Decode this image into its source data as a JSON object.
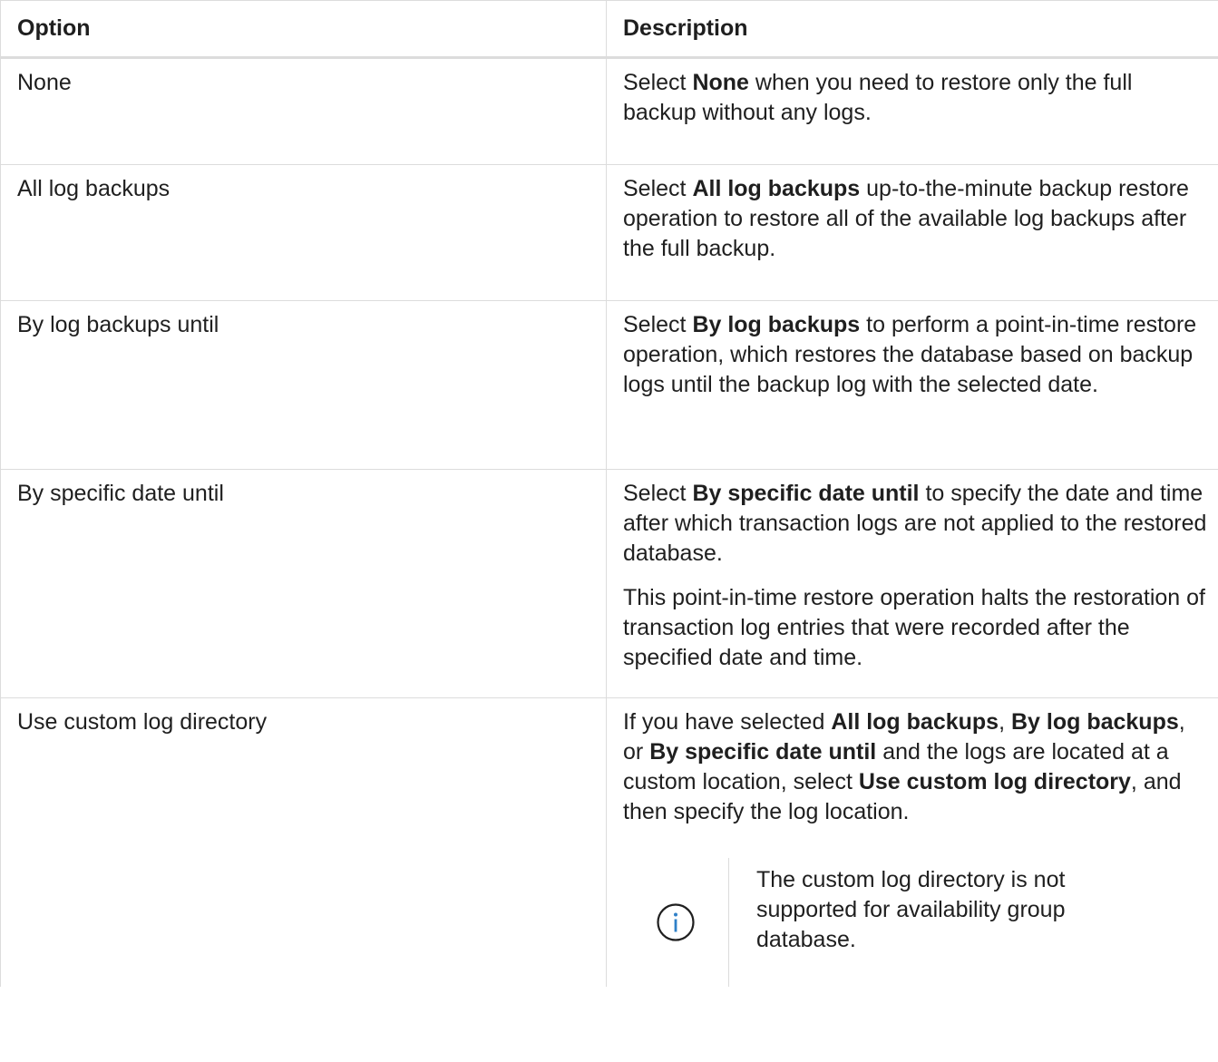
{
  "table": {
    "headers": {
      "option": "Option",
      "description": "Description"
    },
    "rows": [
      {
        "option": "None",
        "desc_pre": "Select ",
        "desc_bold": "None",
        "desc_post": " when you need to restore only the full backup without any logs."
      },
      {
        "option": "All log backups",
        "desc_pre": "Select ",
        "desc_bold": "All log backups",
        "desc_post": " up-to-the-minute backup restore operation to restore all of the available log backups after the full backup."
      },
      {
        "option": "By log backups until",
        "desc_pre": "Select ",
        "desc_bold": "By log backups",
        "desc_post": " to perform a point-in-time restore operation, which restores the database based on backup logs until the backup log with the selected date."
      },
      {
        "option": "By specific date until",
        "desc_pre": "Select ",
        "desc_bold": "By specific date until",
        "desc_post": " to specify the date and time after which transaction logs are not applied to the restored database.",
        "desc_para2": "This point-in-time restore operation halts the restoration of transaction log entries that were recorded after the specified date and time."
      },
      {
        "option": "Use custom log directory",
        "p1": "If you have selected ",
        "b1": "All log backups",
        "p2": ", ",
        "b2": "By log backups",
        "p3": ", or ",
        "b3": "By specific date until",
        "p4": " and the logs are located at a custom location, select ",
        "b4": "Use custom log directory",
        "p5": ", and then specify the log location.",
        "note": {
          "icon": "info-icon",
          "text": "The custom log directory is not supported for availability group database."
        }
      }
    ]
  }
}
